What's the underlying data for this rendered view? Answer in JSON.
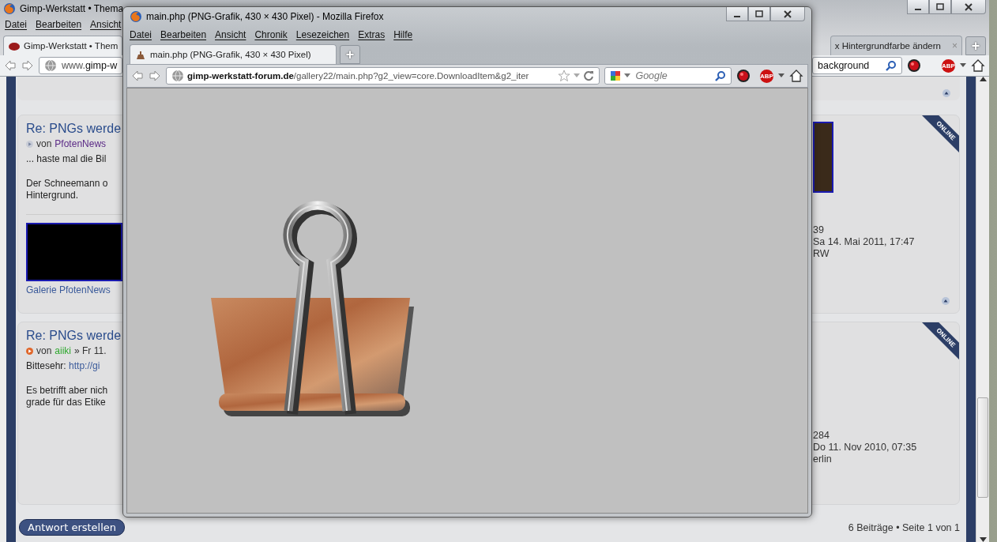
{
  "background_window": {
    "title": "Gimp-Werkstatt • Thema",
    "menu": [
      "Datei",
      "Bearbeiten",
      "Ansicht"
    ],
    "tabs": [
      {
        "label": "Gimp-Werkstatt • Them",
        "selected": true
      },
      {
        "label": "x Hintergrundfarbe ändern",
        "selected": false,
        "close": "×"
      }
    ],
    "new_tab": "+",
    "address": {
      "prefix": "www.",
      "host": "gimp-w"
    },
    "search": {
      "value": "background"
    },
    "adblock": "ABP",
    "posts": [
      {
        "title": "Re: PNGs werde",
        "by": "von",
        "author": "PfotenNews",
        "color": "#5b2a86",
        "unread": false,
        "body": [
          {
            "lines": [
              "... haste mal die Bil"
            ]
          },
          {
            "lines": [
              "Der Schneemann o",
              "Hintergrund."
            ]
          }
        ],
        "signature": {
          "link": "Galerie PfotenNews"
        },
        "profile": [
          "39",
          "Sa 14. Mai 2011, 17:47",
          "RW"
        ],
        "badge": "ONLINE"
      },
      {
        "title": "Re: PNGs werde",
        "by": "von",
        "author": "aiiki",
        "color": "#2ea82e",
        "unread": true,
        "meta": "» Fr 11.",
        "body": [
          {
            "lines": [
              "Bittesehr:"
            ],
            "link": "http://gi"
          },
          {
            "lines": [
              "Es betrifft aber nich",
              "grade für das Etike"
            ]
          }
        ],
        "profile": [
          "284",
          "Do 11. Nov 2010, 07:35",
          "erlin"
        ],
        "badge": "ONLINE"
      }
    ],
    "reply_button": "Antwort erstellen",
    "pagination": "6 Beiträge • Seite 1 von 1"
  },
  "foreground_window": {
    "title": "main.php (PNG-Grafik, 430 × 430 Pixel) - Mozilla Firefox",
    "menu": [
      "Datei",
      "Bearbeiten",
      "Ansicht",
      "Chronik",
      "Lesezeichen",
      "Extras",
      "Hilfe"
    ],
    "tabs": [
      {
        "label": "main.php (PNG-Grafik, 430 × 430 Pixel)",
        "selected": true
      }
    ],
    "new_tab": "+",
    "address": {
      "host": "gimp-werkstatt-forum.de",
      "path": "/gallery22/main.php?g2_view=core.DownloadItem&g2_iter"
    },
    "search": {
      "placeholder": "Google"
    },
    "adblock": "ABP"
  }
}
